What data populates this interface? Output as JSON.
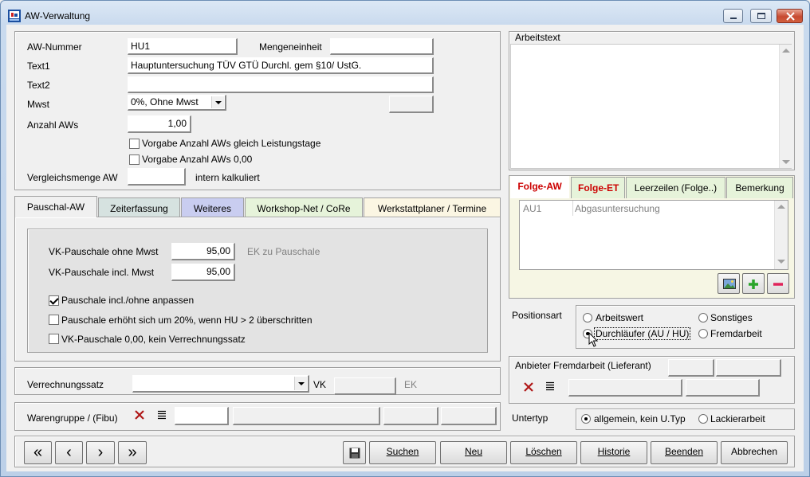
{
  "window": {
    "title": "AW-Verwaltung"
  },
  "form": {
    "aw_nummer_label": "AW-Nummer",
    "aw_nummer_value": "HU1",
    "mengeneinheit_label": "Mengeneinheit",
    "mengeneinheit_value": "",
    "text1_label": "Text1",
    "text1_value": "Hauptuntersuchung TÜV GTÜ Durchl. gem §10/ UstG.",
    "text2_label": "Text2",
    "text2_value": "",
    "mwst_label": "Mwst",
    "mwst_value": "0%, Ohne Mwst",
    "anzahl_label": "Anzahl AWs",
    "anzahl_value": "1,00",
    "vorgabe_leistungstage": "Vorgabe Anzahl AWs gleich Leistungstage",
    "vorgabe_null": "Vorgabe Anzahl AWs 0,00",
    "vergleichsmenge_label": "Vergleichsmenge AW",
    "vergleichsmenge_value": "",
    "intern_kalkuliert": "intern kalkuliert"
  },
  "tabs": [
    {
      "label": "Pauschal-AW",
      "color": "#f0f0f0"
    },
    {
      "label": "Zeiterfassung",
      "color": "#d6e2e0"
    },
    {
      "label": "Weiteres",
      "color": "#c9cdf0"
    },
    {
      "label": "Workshop-Net / CoRe",
      "color": "#e6f3da"
    },
    {
      "label": "Werkstattplaner / Termine",
      "color": "#fbf6e3"
    }
  ],
  "pauschal": {
    "vk_ohne_label": "VK-Pauschale ohne Mwst",
    "vk_ohne_value": "95,00",
    "ek_zu_pauschale": "EK zu Pauschale",
    "vk_incl_label": "VK-Pauschale incl. Mwst",
    "vk_incl_value": "95,00",
    "anpassen": "Pauschale incl./ohne anpassen",
    "erhoeht": "Pauschale erhöht sich um 20%, wenn HU > 2 überschritten",
    "vk_null": "VK-Pauschale 0,00, kein Verrechnungssatz"
  },
  "verrechnung": {
    "label": "Verrechnungssatz",
    "value": "",
    "vk": "VK",
    "ek": "EK"
  },
  "warengruppe": {
    "label": "Warengruppe / (Fibu)"
  },
  "arbeitstext": {
    "label": "Arbeitstext",
    "value": ""
  },
  "folge_tabs": [
    {
      "label": "Folge-AW",
      "color": "#ffffff",
      "text_color": "#cc0000"
    },
    {
      "label": "Folge-ET",
      "color": "#e6f3da",
      "text_color": "#cc0000"
    },
    {
      "label": "Leerzeilen (Folge..)",
      "color": "#e6f3da",
      "text_color": "#000000"
    },
    {
      "label": "Bemerkung",
      "color": "#e6f3da",
      "text_color": "#000000"
    }
  ],
  "folge_list": [
    {
      "code": "AU1",
      "text": "Abgasuntersuchung"
    }
  ],
  "positionsart": {
    "label": "Positionsart",
    "arbeitswert": "Arbeitswert",
    "sonstiges": "Sonstiges",
    "durchlaeufer": "Durchläufer (AU / HU)",
    "fremdarbeit": "Fremdarbeit"
  },
  "anbieter": {
    "label": "Anbieter Fremdarbeit (Lieferant)"
  },
  "untertyp": {
    "label": "Untertyp",
    "allgemein": "allgemein, kein U.Typ",
    "lackier": "Lackierarbeit"
  },
  "buttons": {
    "first": "«",
    "prev": "‹",
    "next": "›",
    "last": "»",
    "suchen": "Suchen",
    "neu": "Neu",
    "loeschen": "Löschen",
    "historie": "Historie",
    "beenden": "Beenden",
    "abbrechen": "Abbrechen"
  }
}
